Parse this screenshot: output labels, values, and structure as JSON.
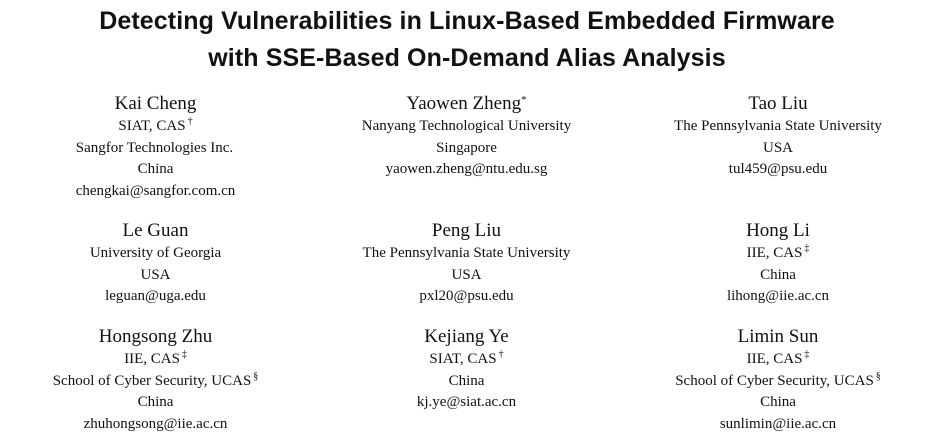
{
  "paper": {
    "title_line1": "Detecting Vulnerabilities in Linux-Based Embedded Firmware",
    "title_line2": "with SSE-Based On-Demand Alias Analysis"
  },
  "authors": [
    {
      "name": "Kai Cheng",
      "name_mark": "",
      "lines": [
        {
          "text": "SIAT, CAS",
          "mark": "†"
        },
        {
          "text": "Sangfor Technologies Inc.",
          "mark": ""
        },
        {
          "text": "China",
          "mark": ""
        },
        {
          "text": "chengkai@sangfor.com.cn",
          "mark": ""
        }
      ]
    },
    {
      "name": "Yaowen Zheng",
      "name_mark": "*",
      "lines": [
        {
          "text": "Nanyang Technological University",
          "mark": ""
        },
        {
          "text": "Singapore",
          "mark": ""
        },
        {
          "text": "yaowen.zheng@ntu.edu.sg",
          "mark": ""
        }
      ]
    },
    {
      "name": "Tao Liu",
      "name_mark": "",
      "lines": [
        {
          "text": "The Pennsylvania State University",
          "mark": ""
        },
        {
          "text": "USA",
          "mark": ""
        },
        {
          "text": "tul459@psu.edu",
          "mark": ""
        }
      ]
    },
    {
      "name": "Le Guan",
      "name_mark": "",
      "lines": [
        {
          "text": "University of Georgia",
          "mark": ""
        },
        {
          "text": "USA",
          "mark": ""
        },
        {
          "text": "leguan@uga.edu",
          "mark": ""
        }
      ]
    },
    {
      "name": "Peng Liu",
      "name_mark": "",
      "lines": [
        {
          "text": "The Pennsylvania State University",
          "mark": ""
        },
        {
          "text": "USA",
          "mark": ""
        },
        {
          "text": "pxl20@psu.edu",
          "mark": ""
        }
      ]
    },
    {
      "name": "Hong Li",
      "name_mark": "",
      "lines": [
        {
          "text": "IIE, CAS",
          "mark": "‡"
        },
        {
          "text": "China",
          "mark": ""
        },
        {
          "text": "lihong@iie.ac.cn",
          "mark": ""
        }
      ]
    },
    {
      "name": "Hongsong Zhu",
      "name_mark": "",
      "lines": [
        {
          "text": "IIE, CAS",
          "mark": "‡"
        },
        {
          "text": "School of Cyber Security, UCAS",
          "mark": "§"
        },
        {
          "text": "China",
          "mark": ""
        },
        {
          "text": "zhuhongsong@iie.ac.cn",
          "mark": ""
        }
      ]
    },
    {
      "name": "Kejiang Ye",
      "name_mark": "",
      "lines": [
        {
          "text": "SIAT, CAS",
          "mark": "†"
        },
        {
          "text": "China",
          "mark": ""
        },
        {
          "text": "kj.ye@siat.ac.cn",
          "mark": ""
        }
      ]
    },
    {
      "name": "Limin Sun",
      "name_mark": "",
      "lines": [
        {
          "text": "IIE, CAS",
          "mark": "‡"
        },
        {
          "text": "School of Cyber Security, UCAS",
          "mark": "§"
        },
        {
          "text": "China",
          "mark": ""
        },
        {
          "text": "sunlimin@iie.ac.cn",
          "mark": ""
        }
      ]
    }
  ]
}
